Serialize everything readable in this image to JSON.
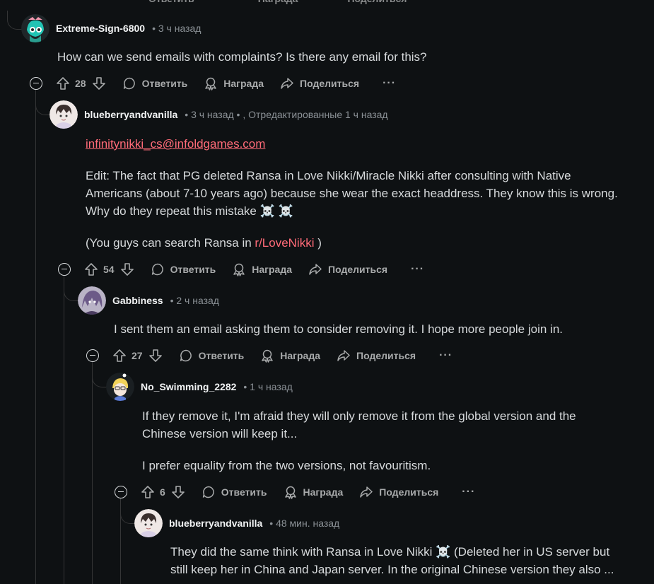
{
  "comments": [
    {
      "username": "Extreme-Sign-6800",
      "meta": "• 3 ч назад",
      "text": "How can we send emails with complaints? Is there any email for this?",
      "score": "28"
    },
    {
      "username": "blueberryandvanilla",
      "meta": "• 3 ч назад • , Отредактированные 1 ч назад",
      "email": "infinitynikki_cs@infoldgames.com",
      "text1": "Edit: The fact that PG deleted Ransa in Love Nikki/Miracle Nikki after consulting with Native Americans (about 7-10 years ago) because she wear the exact headdress. They know this is wrong. Why do they repeat this mistake ☠️ ☠️",
      "text2_prefix": "(You guys can search Ransa in ",
      "subreddit": "r/LoveNikki",
      "text2_suffix": " )",
      "score": "54"
    },
    {
      "username": "Gabbiness",
      "meta": "• 2 ч назад",
      "text": "I sent them an email asking them to consider removing it. I hope more people join in.",
      "score": "27"
    },
    {
      "username": "No_Swimming_2282",
      "meta": "• 1 ч назад",
      "text1": "If they remove it, I'm afraid they will only remove it from the global version and the Chinese version will keep it...",
      "text2": "I prefer equality from the two versions, not favouritism.",
      "score": "6"
    },
    {
      "username": "blueberryandvanilla",
      "meta": "• 48 мин. назад",
      "text": "They did the same think with Ransa in Love Nikki ☠️  (Deleted her in US server but still keep her in China and Japan server. In the original Chinese version they also ..."
    }
  ],
  "actions": {
    "reply": "Ответить",
    "award": "Награда",
    "share": "Поделиться",
    "more": "···"
  },
  "colors": {
    "background": "#0e1113",
    "link": "#ff6b78",
    "text": "#d7dadc",
    "muted": "#8b9196"
  }
}
